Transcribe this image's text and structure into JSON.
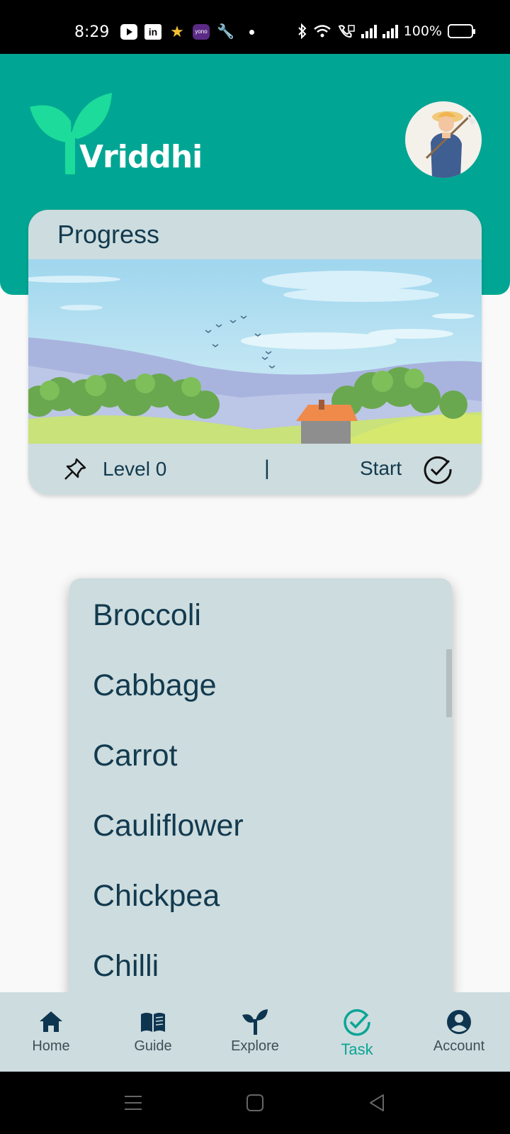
{
  "status_bar": {
    "time": "8:29",
    "battery": "100%",
    "icons": [
      "youtube-icon",
      "linkedin-icon",
      "star-icon",
      "yono-sbi-icon",
      "wrench-icon",
      "dot-icon",
      "bluetooth-icon",
      "wifi-icon",
      "vowifi-icon",
      "signal-icon",
      "signal-icon",
      "battery-icon"
    ]
  },
  "header": {
    "app_name": "Vriddhi",
    "brand_color": "#00a693"
  },
  "progress_card": {
    "title": "Progress",
    "level_label": "Level 0",
    "separator": "|",
    "start_label": "Start"
  },
  "dropdown": {
    "items": [
      "Broccoli",
      "Cabbage",
      "Carrot",
      "Cauliflower",
      "Chickpea",
      "Chilli"
    ]
  },
  "bottom_nav": {
    "items": [
      {
        "label": "Home",
        "icon": "home-icon",
        "active": false
      },
      {
        "label": "Guide",
        "icon": "book-icon",
        "active": false
      },
      {
        "label": "Explore",
        "icon": "sprout-icon",
        "active": false
      },
      {
        "label": "Task",
        "icon": "check-circle-icon",
        "active": true
      },
      {
        "label": "Account",
        "icon": "account-icon",
        "active": false
      }
    ],
    "active_color": "#0aa596"
  },
  "system_nav": {
    "buttons": [
      "menu-icon",
      "home-square-icon",
      "back-triangle-icon"
    ]
  }
}
